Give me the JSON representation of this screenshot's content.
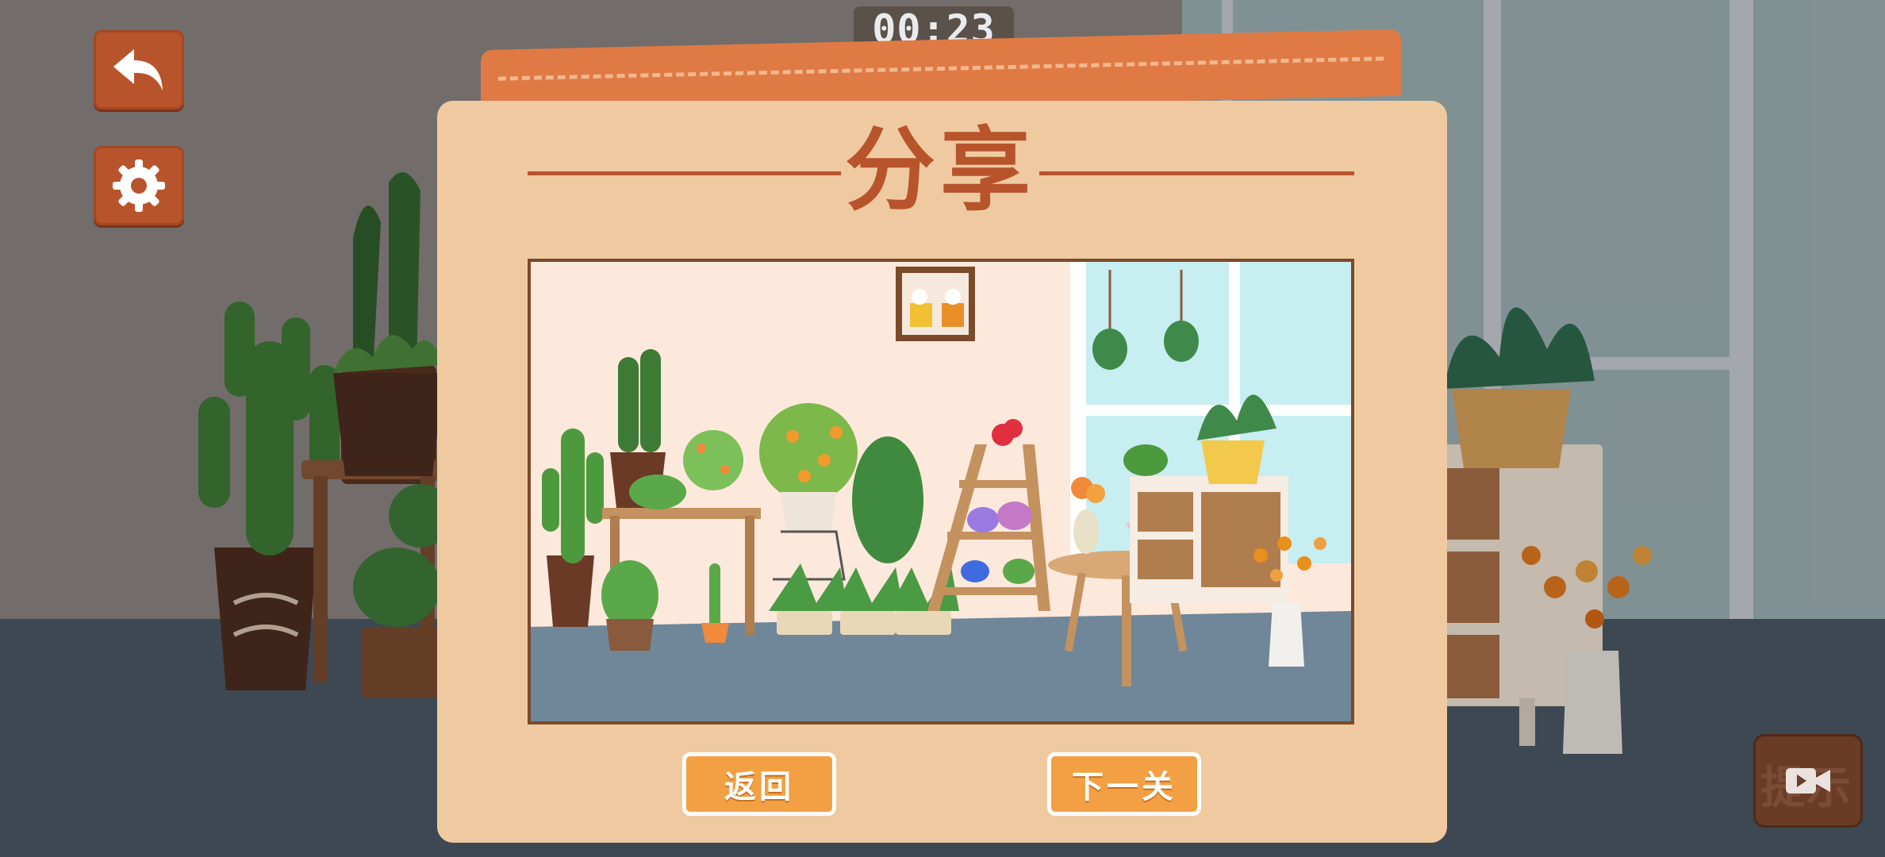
{
  "timer": "00:23",
  "dialog": {
    "title": "分享",
    "back_label": "返回",
    "next_label": "下一关"
  },
  "toolbar": {
    "back_icon": "undo-arrow-icon",
    "settings_icon": "gear-icon"
  },
  "hint": {
    "label": "提示",
    "icon": "video-camera-icon"
  },
  "colors": {
    "accent": "#b8542c",
    "panel": "#efcaa1",
    "tab": "#e07a45",
    "button": "#f2a043"
  }
}
